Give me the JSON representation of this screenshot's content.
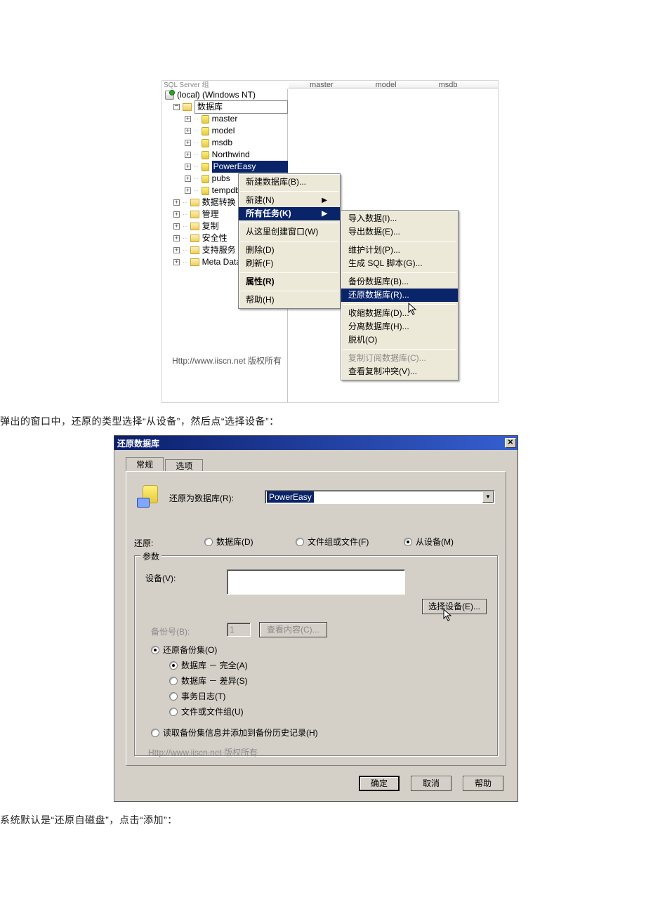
{
  "fig1": {
    "listTop": {
      "c1": "master",
      "c2": "model",
      "c3": "msdb",
      "cut": "SQL Server 组"
    },
    "tree": {
      "server": "(local) (Windows NT)",
      "dbGroup": "数据库",
      "dbs": [
        "master",
        "model",
        "msdb",
        "Northwind",
        "PowerEasy",
        "pubs",
        "tempdb"
      ],
      "others": [
        "数据转换",
        "管理",
        "复制",
        "安全性",
        "支持服务",
        "Meta Data"
      ]
    },
    "menu1": {
      "newDb": "新建数据库(B)...",
      "new_": "新建(N)",
      "allTasks": "所有任务(K)",
      "newWindow": "从这里创建窗口(W)",
      "delete_": "删除(D)",
      "refresh": "刷新(F)",
      "properties": "属性(R)",
      "help": "帮助(H)"
    },
    "menu2": {
      "import_": "导入数据(I)...",
      "export_": "导出数据(E)...",
      "maint": "维护计划(P)...",
      "genScript": "生成 SQL 脚本(G)...",
      "backup": "备份数据库(B)...",
      "restore": "还原数据库(R)...",
      "shrink": "收缩数据库(D)...",
      "detach": "分离数据库(H)...",
      "offline": "脱机(O)",
      "copySub": "复制订阅数据库(C)...",
      "viewConf": "查看复制冲突(V)..."
    },
    "watermark": "Http://www.iiscn.net 版权所有"
  },
  "text1": "弹出的窗口中，还原的类型选择“从设备”，然后点“选择设备”：",
  "dialog": {
    "title": "还原数据库",
    "tabGeneral": "常规",
    "tabOptions": "选项",
    "restoreAsLbl": "还原为数据库(R):",
    "restoreAsVal": "PowerEasy",
    "restoreLbl": "还原:",
    "rDb": "数据库(D)",
    "rFile": "文件组或文件(F)",
    "rDevice": "从设备(M)",
    "paramsLegend": "参数",
    "deviceLbl": "设备(V):",
    "chooseDevice": "选择设备(E)...",
    "backupNoLbl": "备份号(B):",
    "backupNoVal": "1",
    "viewContents": "查看内容(C)...",
    "restoreSet": "还原备份集(O)",
    "setFull": "数据库 － 完全(A)",
    "setDiff": "数据库 － 差异(S)",
    "setLog": "事务日志(T)",
    "setFileGrp": "文件或文件组(U)",
    "readInfo": "读取备份集信息并添加到备份历史记录(H)",
    "watermark": "Http://www.iiscn.net 版权所有",
    "ok": "确定",
    "cancel": "取消",
    "help": "帮助"
  },
  "text2": "系统默认是“还原自磁盘”，点击“添加”："
}
